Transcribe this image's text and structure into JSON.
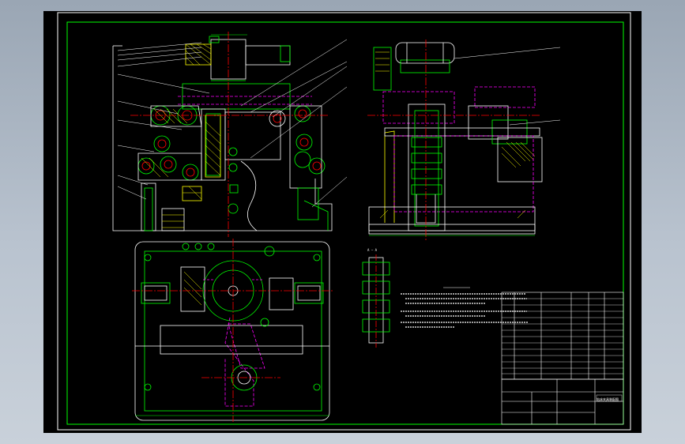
{
  "sheet": {
    "background_color": "#000000",
    "frame_color": "#00ff00",
    "outline_color": "#ffffff",
    "hidden_line_color": "#ff00ff",
    "center_line_color": "#ff0000",
    "hatch_color": "#ffff00"
  },
  "labels": {
    "section_aa": "A — A"
  },
  "title_block": {
    "name": "钻床夹具装配图"
  },
  "icons": [
    "drawing-canvas"
  ]
}
